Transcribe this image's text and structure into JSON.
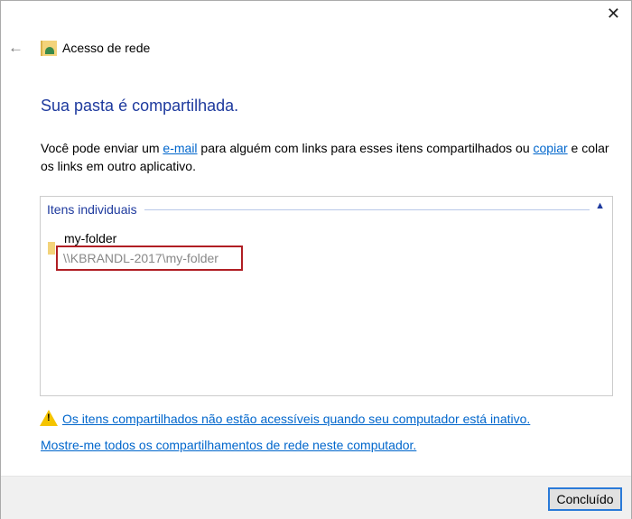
{
  "window": {
    "title": "Acesso de rede",
    "close": "✕",
    "back": "←"
  },
  "heading": "Sua pasta é compartilhada.",
  "description": {
    "part1": "Você pode enviar um ",
    "link_email": "e-mail",
    "part2": " para alguém com links para esses itens compartilhados ou ",
    "link_copy": "copiar",
    "part3": " e colar os links em outro aplicativo."
  },
  "items_group": {
    "label": "Itens individuais",
    "items": [
      {
        "name": "my-folder",
        "path": "\\\\KBRANDL-2017\\my-folder"
      }
    ]
  },
  "links": {
    "warning": "Os itens compartilhados não estão acessíveis quando seu computador está inativo.",
    "show_all": "Mostre-me todos os compartilhamentos de rede neste computador."
  },
  "buttons": {
    "done": "Concluído"
  }
}
